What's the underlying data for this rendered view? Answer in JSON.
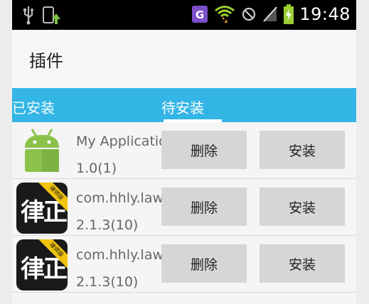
{
  "status_bar": {
    "time": "19:48",
    "icons": [
      "usb-icon",
      "notification-app-icon",
      "g-app-icon",
      "wifi-icon",
      "no-sim-icon",
      "signal-icon",
      "battery-charging-icon"
    ]
  },
  "app_bar": {
    "title": "插件"
  },
  "tabs": [
    {
      "label": "已安装",
      "selected": false
    },
    {
      "label": "待安装",
      "selected": true
    }
  ],
  "items": [
    {
      "name": "My Application",
      "version": "1.0(1)",
      "icon": "android-icon",
      "delete_label": "删除",
      "install_label": "安装"
    },
    {
      "name": "com.hhly.lawyer",
      "version": "2.1.3(10)",
      "icon": "lawyer-app-icon",
      "icon_text": "律正",
      "ribbon": "律师版",
      "delete_label": "删除",
      "install_label": "安装"
    },
    {
      "name": "com.hhly.lawyer",
      "version": "2.1.3(10)",
      "icon": "lawyer-app-icon",
      "icon_text": "律正",
      "ribbon": "律师版",
      "delete_label": "删除",
      "install_label": "安装"
    }
  ],
  "colors": {
    "accent": "#33b5e5",
    "status_bar": "#000000",
    "button": "#d6d6d6"
  }
}
